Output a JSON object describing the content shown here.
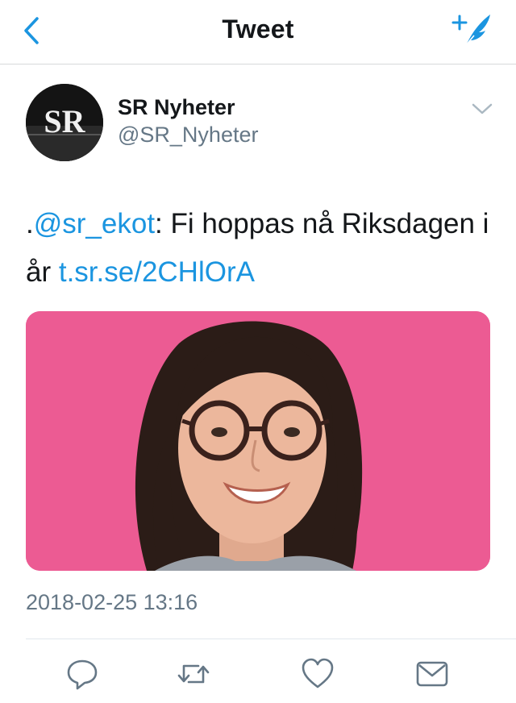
{
  "nav": {
    "back_icon": "chevron-left-icon",
    "title": "Tweet",
    "compose_icon": "compose-tweet-icon"
  },
  "author": {
    "avatar_text": "SR",
    "display_name": "SR Nyheter",
    "handle": "@SR_Nyheter"
  },
  "tweet": {
    "prefix": ".",
    "mention": "@sr_ekot",
    "text_part": ": Fi hoppas nå Riksdagen i år ",
    "link": "t.sr.se/2CHlOrA",
    "timestamp": "2018-02-25 13:16"
  },
  "media": {
    "background_color": "#ec5b93",
    "icon": "photo"
  },
  "actions": {
    "reply_icon": "reply-icon",
    "retweet_icon": "retweet-icon",
    "like_icon": "heart-icon",
    "share_icon": "mail-icon"
  },
  "colors": {
    "accent": "#1b95e0",
    "secondary_text": "#657786",
    "action_icon": "#657786"
  }
}
